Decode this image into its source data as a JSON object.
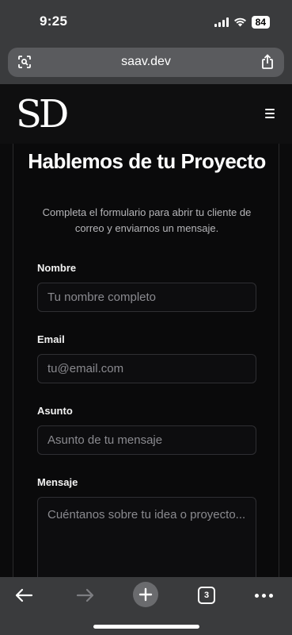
{
  "status": {
    "time": "9:25",
    "battery": "84"
  },
  "browser": {
    "url": "saav.dev",
    "tabs_count": "3"
  },
  "site": {
    "logo": "SD"
  },
  "hero": {
    "title": "Hablemos de tu Proyecto",
    "subtitle": "Completa el formulario para abrir tu cliente de correo y enviarnos un mensaje."
  },
  "form": {
    "name": {
      "label": "Nombre",
      "placeholder": "Tu nombre completo"
    },
    "email": {
      "label": "Email",
      "placeholder": "tu@email.com"
    },
    "subject": {
      "label": "Asunto",
      "placeholder": "Asunto de tu mensaje"
    },
    "message": {
      "label": "Mensaje",
      "placeholder": "Cuéntanos sobre tu idea o proyecto..."
    }
  },
  "icons": {
    "lens": "lens-icon",
    "share": "share-icon",
    "menu": "menu-icon",
    "back": "back-arrow-icon",
    "forward": "forward-arrow-icon",
    "new_tab": "plus-icon",
    "more": "more-icon"
  }
}
